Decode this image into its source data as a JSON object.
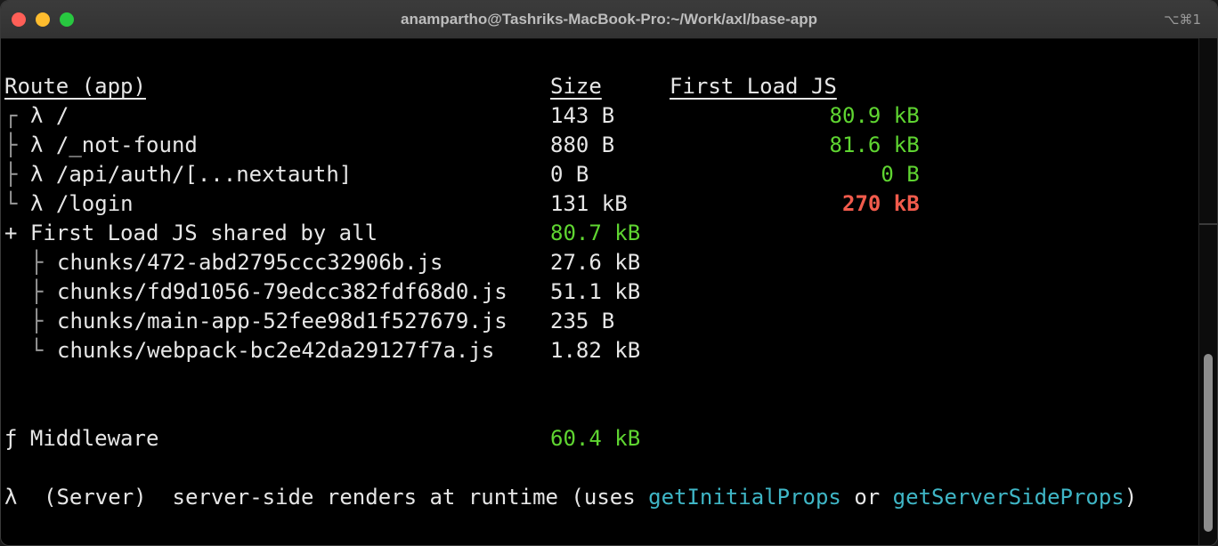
{
  "window": {
    "title": "anampartho@Tashriks-MacBook-Pro:~/Work/axl/base-app",
    "shortcut": "⌥⌘1"
  },
  "header": {
    "route": "Route (app)",
    "size": "Size",
    "first_load": "First Load JS"
  },
  "routes": [
    {
      "tree": "┌",
      "route": "λ /",
      "size": "143 B",
      "first_load": "80.9 kB"
    },
    {
      "tree": "├",
      "route": "λ /_not-found",
      "size": "880 B",
      "first_load": "81.6 kB"
    },
    {
      "tree": "├",
      "route": "λ /api/auth/[...nextauth]",
      "size": "0 B",
      "first_load": "0 B"
    },
    {
      "tree": "└",
      "route": "λ /login",
      "size": "131 kB",
      "first_load": "270 kB"
    }
  ],
  "shared": {
    "label": "+ First Load JS shared by all",
    "size": "80.7 kB",
    "chunks": [
      {
        "tree": "├",
        "name": "chunks/472-abd2795ccc32906b.js",
        "size": "27.6 kB"
      },
      {
        "tree": "├",
        "name": "chunks/fd9d1056-79edcc382fdf68d0.js",
        "size": "51.1 kB"
      },
      {
        "tree": "├",
        "name": "chunks/main-app-52fee98d1f527679.js",
        "size": "235 B"
      },
      {
        "tree": "└",
        "name": "chunks/webpack-bc2e42da29127f7a.js",
        "size": "1.82 kB"
      }
    ]
  },
  "middleware": {
    "label": "ƒ Middleware",
    "size": "60.4 kB"
  },
  "legend": {
    "symbol": "λ",
    "type": "(Server)",
    "text_a": "server-side renders at runtime (uses ",
    "fn1": "getInitialProps",
    "text_b": " or ",
    "fn2": "getServerSideProps",
    "text_c": ")"
  },
  "colors": {
    "green": "#5fd531",
    "red": "#f15b4c",
    "cyan": "#3fb6c6"
  }
}
